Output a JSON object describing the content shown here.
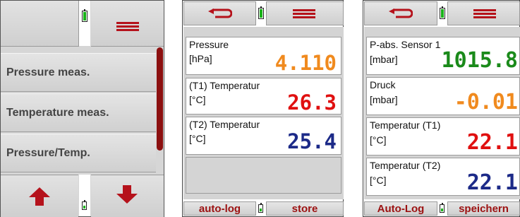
{
  "colors": {
    "accent_red": "#b5121b",
    "battery_green": "#19b219",
    "scroll_thumb": "#8c1010"
  },
  "menu_screen": {
    "items": [
      {
        "label": "Pressure meas."
      },
      {
        "label": "Temperature meas."
      },
      {
        "label": "Pressure/Temp."
      }
    ],
    "icons": [
      "battery-icon",
      "hamburger-menu-icon",
      "arrow-up-icon",
      "arrow-down-icon",
      "battery-icon"
    ]
  },
  "screen_en": {
    "fields": [
      {
        "label": "Pressure",
        "unit": "[hPa]",
        "value": "4.110",
        "color": "#f08a1e"
      },
      {
        "label": "(T1) Temperatur",
        "unit": "[°C]",
        "value": "26.3",
        "color": "#e01010"
      },
      {
        "label": "(T2) Temperatur",
        "unit": "[°C]",
        "value": "25.4",
        "color": "#1c2a88"
      }
    ],
    "autolog_label": "auto-log",
    "store_label": "store"
  },
  "screen_de": {
    "fields": [
      {
        "label": "P-abs. Sensor 1",
        "unit": "[mbar]",
        "value": "1015.8",
        "color": "#1a8a1a"
      },
      {
        "label": "Druck",
        "unit": "[mbar]",
        "value": "-0.01",
        "color": "#f08a1e"
      },
      {
        "label": "Temperatur (T1)",
        "unit": "[°C]",
        "value": "22.1",
        "color": "#e01010"
      },
      {
        "label": "Temperatur (T2)",
        "unit": "[°C]",
        "value": "22.1",
        "color": "#1c2a88"
      }
    ],
    "autolog_label": "Auto-Log",
    "store_label": "speichern"
  }
}
